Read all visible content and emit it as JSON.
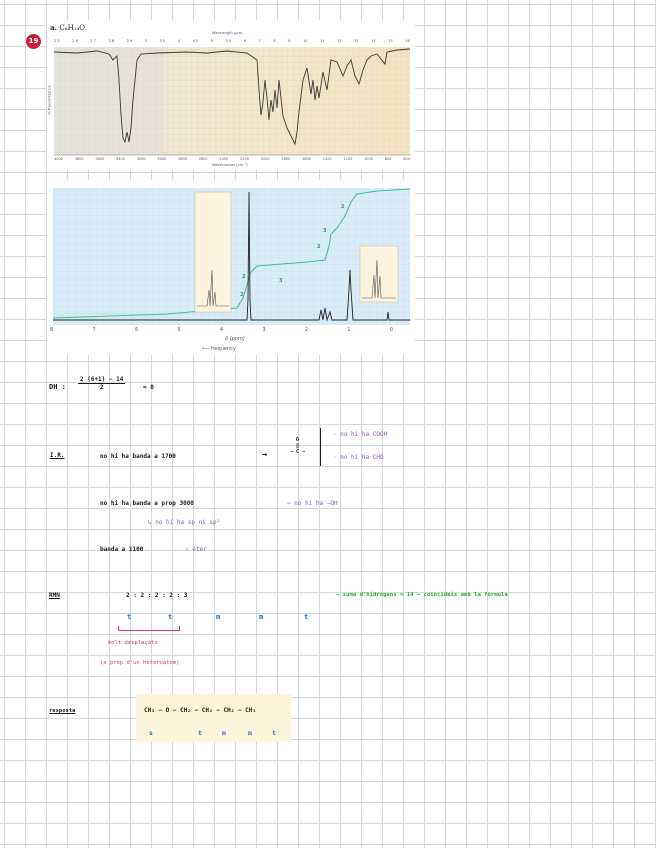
{
  "problem": {
    "number": "19",
    "formula_prefix": "a. ",
    "formula": "C₆H₁₄O"
  },
  "ir_spectrum": {
    "top_axis_label": "Wavelength (μm)",
    "bottom_axis_label": "Wavenumber (cm⁻¹)",
    "y_axis_label": "% Transmittance",
    "top_ticks": [
      "2.5",
      "2.6",
      "2.7",
      "2.8",
      "2.9",
      "3",
      "3.5",
      "4",
      "4.5",
      "5",
      "5.5",
      "6",
      "7",
      "8",
      "9",
      "10",
      "11",
      "12",
      "13",
      "14",
      "15",
      "16"
    ],
    "bottom_ticks": [
      "4000",
      "3800",
      "3600",
      "3400",
      "3200",
      "3000",
      "2800",
      "2600",
      "2400",
      "2200",
      "2000",
      "1800",
      "1600",
      "1400",
      "1200",
      "1000",
      "800",
      "600"
    ]
  },
  "nmr_spectrum": {
    "x_ticks": [
      "8",
      "7",
      "6",
      "5",
      "4",
      "3",
      "2",
      "1",
      "0"
    ],
    "x_label": "δ (ppm)",
    "freq_label": "frequency",
    "integrations": [
      "2",
      "2",
      "2",
      "3",
      "2",
      "3"
    ]
  },
  "notes": {
    "dh_label": "DH :",
    "dh_numerator": "2 (6+1) − 14",
    "dh_denominator": "2",
    "dh_result": "= 0",
    "ir_label": "I.R.",
    "ir_line1": "no  hi  ha   banda   a   1700",
    "ir_arrow": "→",
    "ir_carbonyl_o": "O",
    "ir_carbonyl_dbl": "‖",
    "ir_carbonyl_c": "− C −",
    "ir_branch1": "· no  hi  ha  COOH",
    "ir_branch2": "· no  hi  ha  CHO",
    "ir_line2": "no  hi  ha   banda   a   prop  3000",
    "ir_line2_result": "⇒  no  hi  ha  −OH",
    "ir_line3": "↳  no  hi  ha  sp  ni  sp²",
    "ir_line4": "banda   a   1100",
    "ir_line4_result": "⇒  éter",
    "rmn_label": "RMN",
    "rmn_ratio": "2   :   2   :   2   :   2   :   3",
    "rmn_sum": "⇒  suma  d'hidrògens  =  14  →  coincideix  amb  la  fórmula",
    "rmn_mult": [
      "t",
      "t",
      "m",
      "m",
      "t"
    ],
    "rmn_note1": "molt desplaçats",
    "rmn_note2": "(a prop d'un heteroàtom)",
    "answer_label": "resposta",
    "answer_formula": "CH₃ − O − CH₂ − CH₂ − CH₂ − CH₃",
    "answer_mult": [
      "s",
      "t",
      "m",
      "m",
      "t"
    ]
  }
}
